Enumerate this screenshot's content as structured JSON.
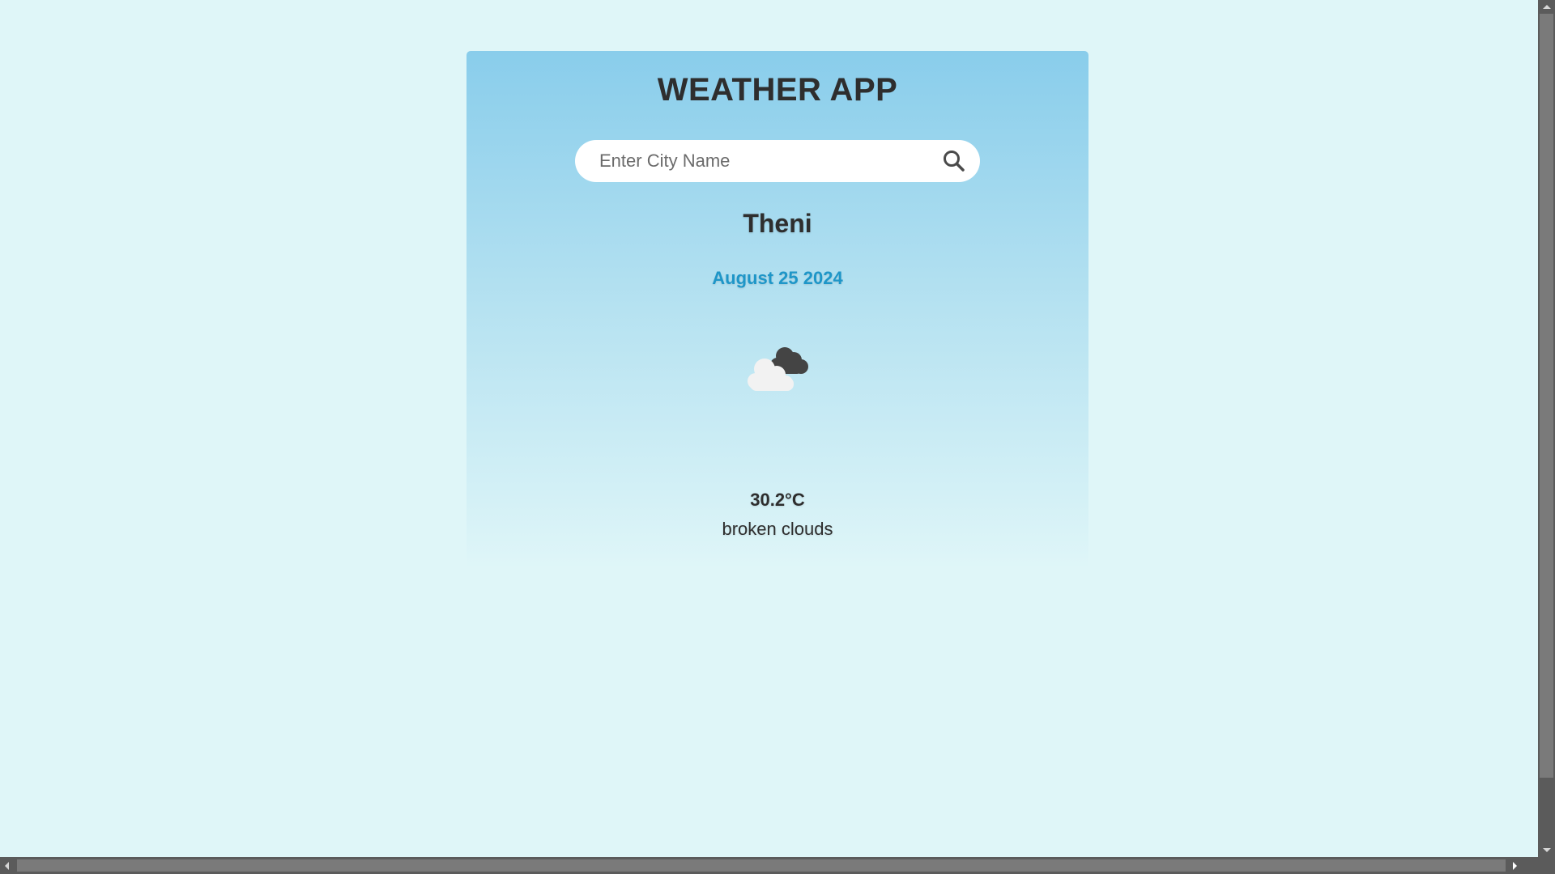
{
  "app": {
    "title": "WEATHER APP"
  },
  "search": {
    "placeholder": "Enter City Name",
    "value": "",
    "icon": "search-icon"
  },
  "weather": {
    "city": "Theni",
    "date": "August 25 2024",
    "icon": "broken-clouds-icon",
    "temperature": "30.2°C",
    "description": "broken clouds"
  },
  "colors": {
    "background": "#dff6f8",
    "card_top": "#89cdeb",
    "date_accent": "#1e96c8",
    "text": "#2e2e2e"
  }
}
